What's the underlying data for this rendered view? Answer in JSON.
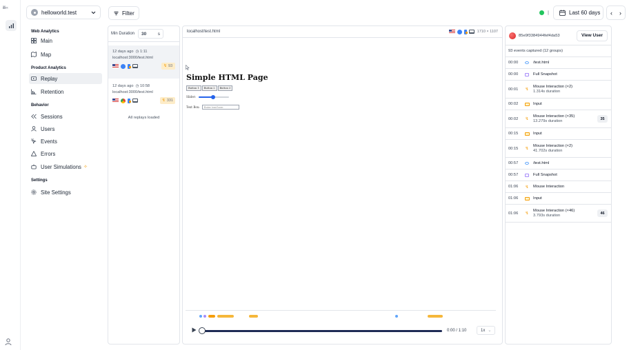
{
  "rail": {
    "logo_text": "illi‹‹"
  },
  "site_selector": {
    "value": "helloworld.test"
  },
  "nav": {
    "sections": [
      {
        "title": "Web Analytics",
        "items": [
          "Main",
          "Map"
        ]
      },
      {
        "title": "Product Analytics",
        "items": [
          "Replay",
          "Retention"
        ]
      },
      {
        "title": "Behavior",
        "items": [
          "Sessions",
          "Users",
          "Events",
          "Errors",
          "User Simulations"
        ]
      },
      {
        "title": "Settings",
        "items": [
          "Site Settings"
        ]
      }
    ],
    "active_item": "Replay"
  },
  "toolbar": {
    "filter_label": "Filter",
    "date_range": "Last 60 days",
    "prev": "‹",
    "next": "›"
  },
  "replay_list": {
    "min_duration_label": "Min Duration",
    "min_duration_value": "30",
    "min_duration_unit": "s",
    "items": [
      {
        "time": "12 days ago",
        "duration": "1:11",
        "url": "localhost:3000/test.html",
        "events": "93",
        "browser_color": "#3b82f6"
      },
      {
        "time": "12 days ago",
        "duration": "10:58",
        "url": "localhost:3000/test.html",
        "events": "331",
        "browser_color": "#ea4335"
      }
    ],
    "footer": "All replays loaded"
  },
  "player": {
    "url": "localhost/test.html",
    "viewport": "1710 × 1107",
    "page": {
      "title": "Simple HTML Page",
      "buttons": [
        "Button 1",
        "Button 2",
        "Button 3"
      ],
      "slider_label": "Slider:",
      "slider_fraction": 0.48,
      "textbox_label": "Text Box:",
      "textbox_placeholder": "Enter text here"
    },
    "time": "0:00 / 1:10",
    "speed": "1x",
    "progress_fraction": 0.0
  },
  "events": {
    "user_id": "85e9f3384944fef4da53",
    "view_user_label": "View User",
    "summary": "93 events captured (12 groups)",
    "rows": [
      {
        "time": "00:00",
        "type": "pageview",
        "label": "/test.html",
        "sub": "",
        "count": ""
      },
      {
        "time": "00:00",
        "type": "snapshot",
        "label": "Full Snapshot",
        "sub": "",
        "count": ""
      },
      {
        "time": "00:01",
        "type": "mouse",
        "label": "Mouse Interaction (×2)",
        "sub": "1.314s duration",
        "count": ""
      },
      {
        "time": "00:02",
        "type": "input",
        "label": "Input",
        "sub": "",
        "count": ""
      },
      {
        "time": "00:02",
        "type": "mouse",
        "label": "Mouse Interaction (×35)",
        "sub": "13.279s duration",
        "count": "35"
      },
      {
        "time": "00:15",
        "type": "input",
        "label": "Input",
        "sub": "",
        "count": ""
      },
      {
        "time": "00:15",
        "type": "mouse",
        "label": "Mouse Interaction (×2)",
        "sub": "41.702s duration",
        "count": ""
      },
      {
        "time": "00:57",
        "type": "pageview",
        "label": "/test.html",
        "sub": "",
        "count": ""
      },
      {
        "time": "00:57",
        "type": "snapshot",
        "label": "Full Snapshot",
        "sub": "",
        "count": ""
      },
      {
        "time": "01:06",
        "type": "mouse",
        "label": "Mouse Interaction",
        "sub": "",
        "count": ""
      },
      {
        "time": "01:06",
        "type": "input",
        "label": "Input",
        "sub": "",
        "count": ""
      },
      {
        "time": "01:06",
        "type": "mouse",
        "label": "Mouse Interaction (×46)",
        "sub": "3.793s duration",
        "count": "46"
      }
    ]
  },
  "colors": {
    "accent": "#1e2b55",
    "live": "#22c55e",
    "mouse": "#f59e0b",
    "pageview": "#60a5fa",
    "snapshot": "#a78bfa"
  }
}
